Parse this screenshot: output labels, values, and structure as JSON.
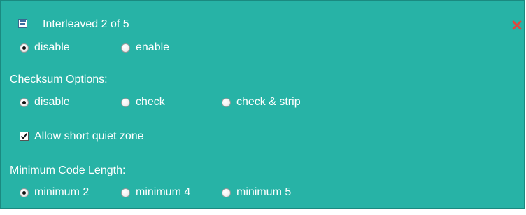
{
  "header": {
    "title": "Interleaved 2 of 5"
  },
  "interleaved": {
    "options": [
      {
        "label": "disable",
        "checked": true
      },
      {
        "label": "enable",
        "checked": false
      }
    ]
  },
  "checksum": {
    "title": "Checksum Options:",
    "options": [
      {
        "label": "disable",
        "checked": true
      },
      {
        "label": "check",
        "checked": false
      },
      {
        "label": "check & strip",
        "checked": false
      }
    ]
  },
  "quiet_zone": {
    "label": "Allow short quiet zone",
    "checked": true
  },
  "min_length": {
    "title": "Minimum Code Length:",
    "options": [
      {
        "label": "minimum 2",
        "checked": true
      },
      {
        "label": "minimum 4",
        "checked": false
      },
      {
        "label": "minimum 5",
        "checked": false
      }
    ]
  },
  "colors": {
    "panel": "#27b3a6",
    "text": "#ffffff",
    "close": "#e0483c"
  },
  "icons": {
    "collapse": "collapse-icon",
    "close": "close-icon"
  }
}
